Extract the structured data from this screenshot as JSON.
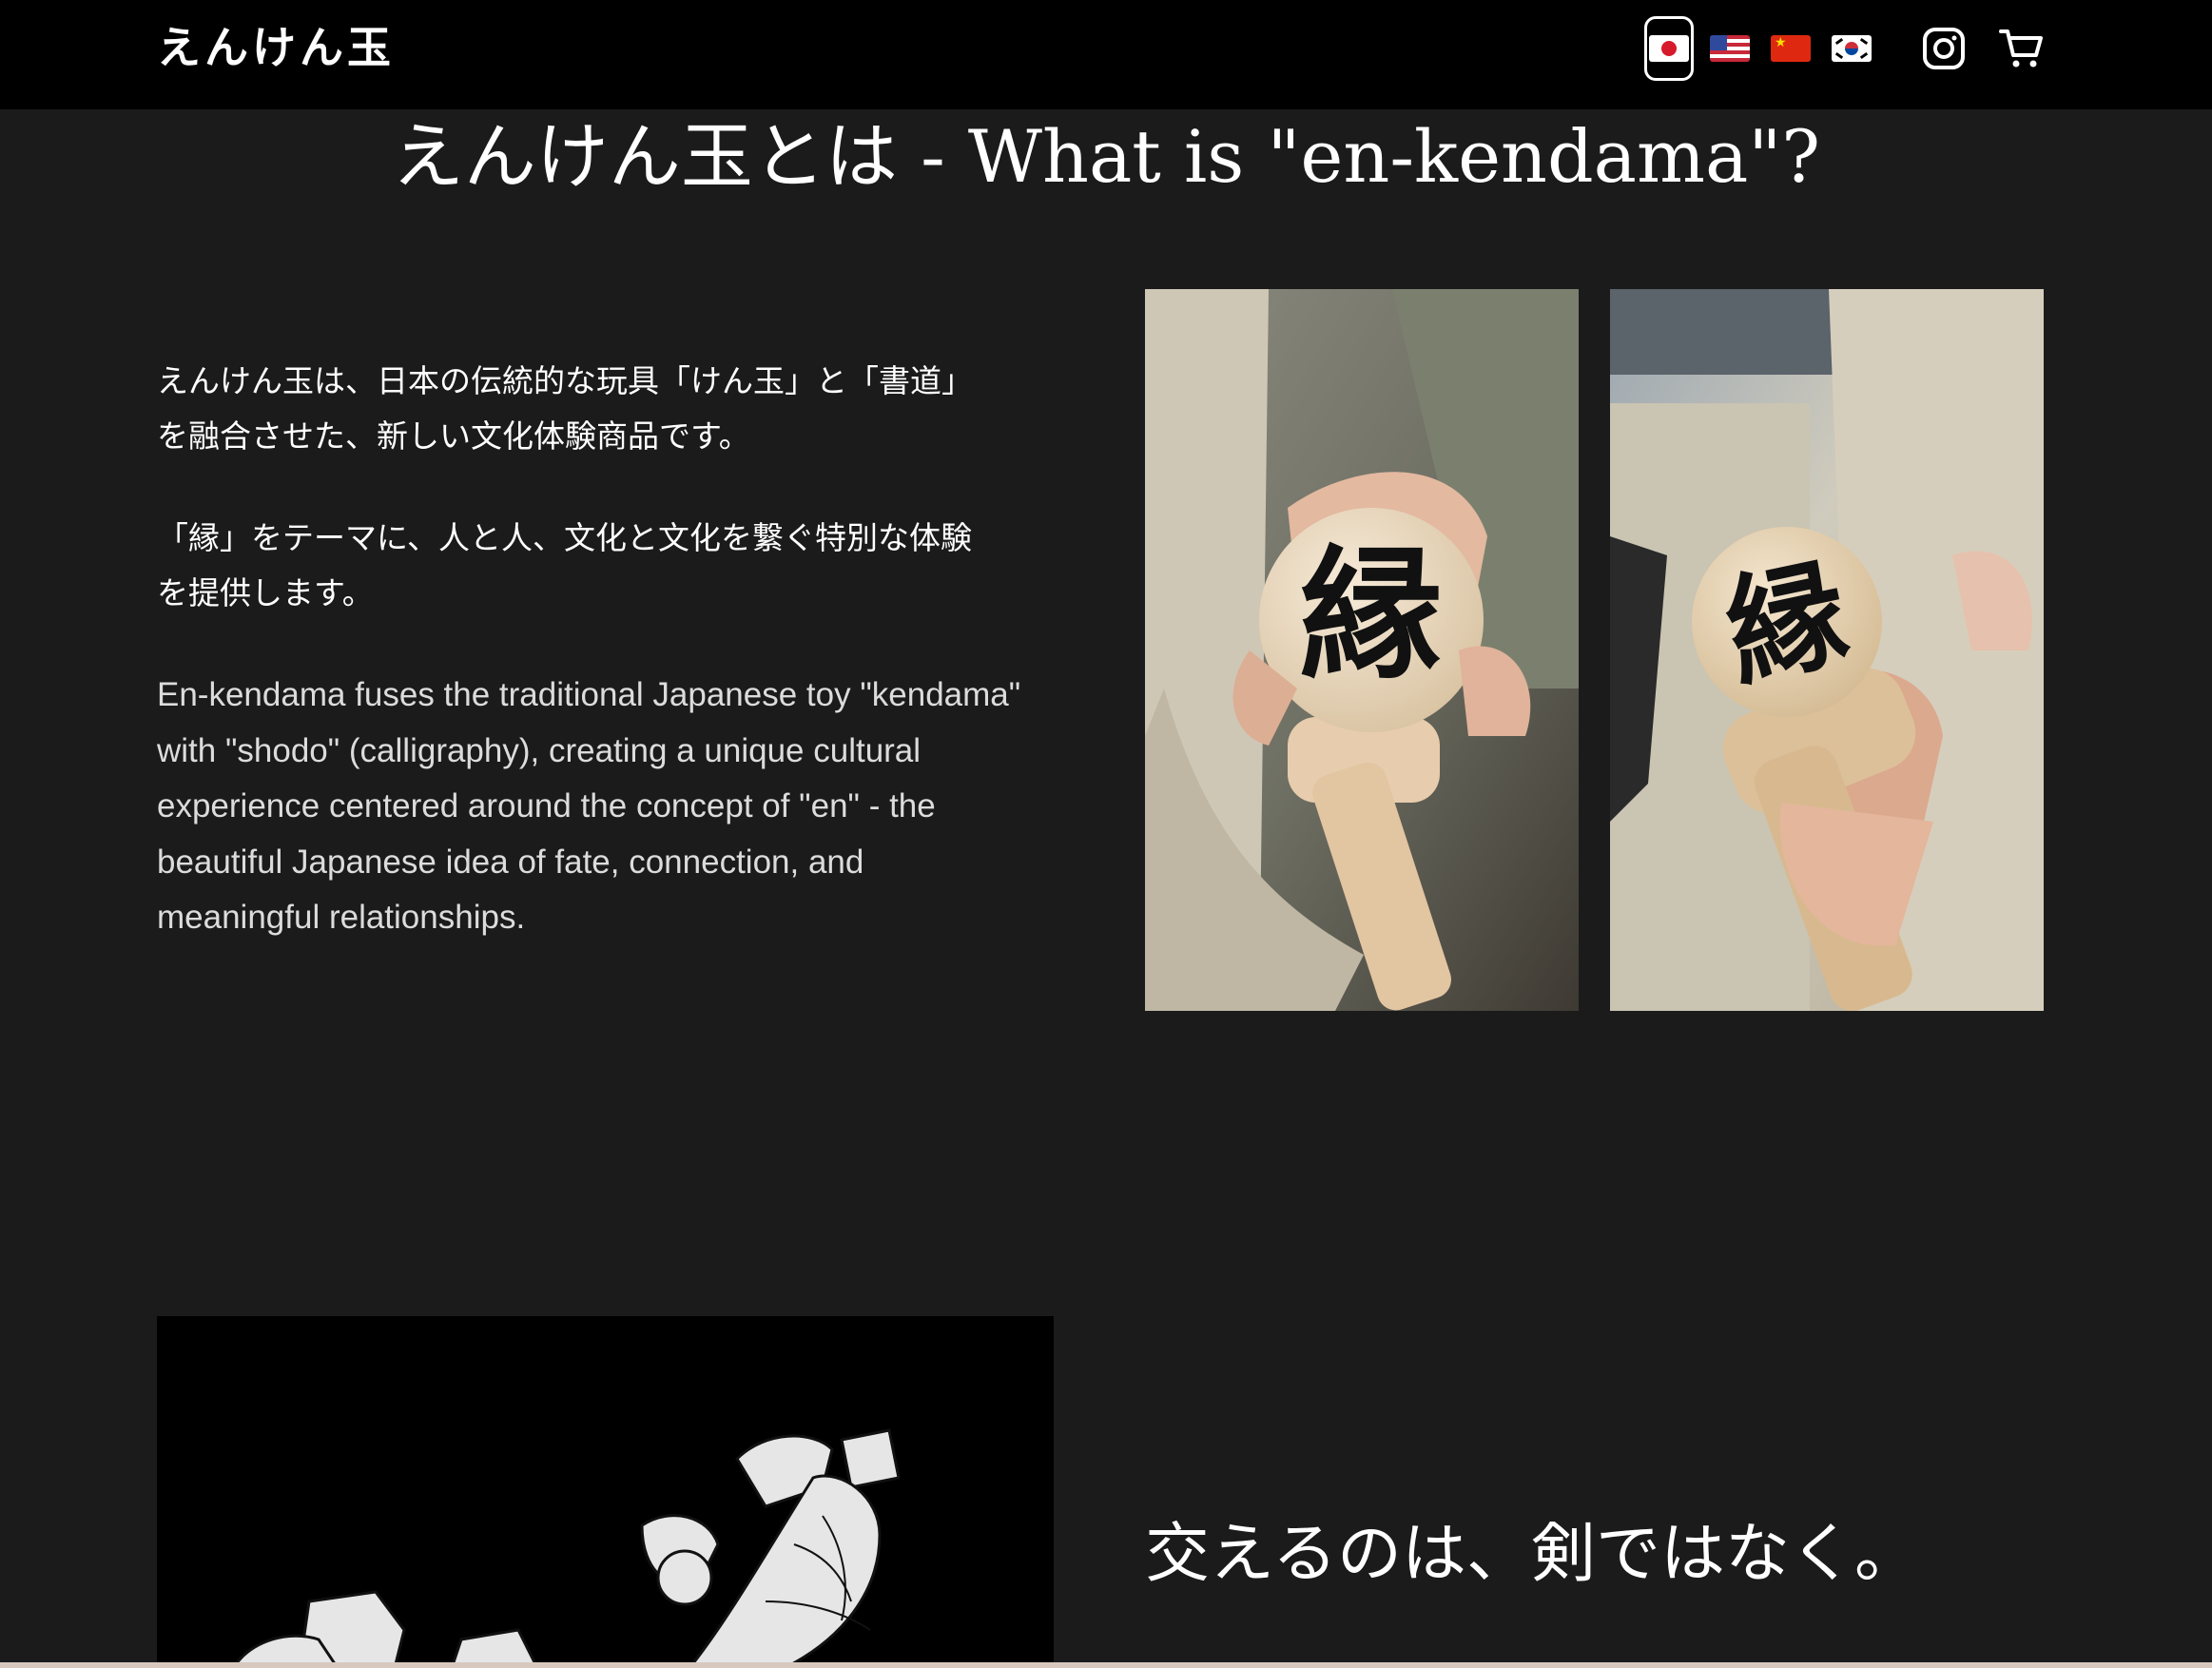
{
  "header": {
    "logo": "えんけん玉",
    "languages": [
      {
        "code": "ja",
        "icon": "japan-flag-icon",
        "active": true
      },
      {
        "code": "en",
        "icon": "usa-flag-icon",
        "active": false
      },
      {
        "code": "zh",
        "icon": "china-flag-icon",
        "active": false
      },
      {
        "code": "ko",
        "icon": "korea-flag-icon",
        "active": false
      }
    ],
    "icons": [
      "instagram-icon",
      "cart-icon"
    ]
  },
  "about": {
    "title": "えんけん玉とは - What is \"en-kendama\"?",
    "jp_para1_line1": "えんけん玉は、日本の伝統的な玩具「けん玉」と「書道」",
    "jp_para1_line2": "を融合させた、新しい文化体験商品です。",
    "jp_para2_line1": "「縁」をテーマに、人と人、文化と文化を繋ぐ特別な体験",
    "jp_para2_line2": "を提供します。",
    "en_lines": [
      "En-kendama fuses the traditional Japanese toy \"kendama\"",
      "with \"shodo\" (calligraphy), creating a unique cultural",
      "experience centered around the concept of \"en\" - the",
      "beautiful Japanese idea of fate, connection, and",
      "meaningful relationships."
    ],
    "photo_glyph": "縁"
  },
  "section2": {
    "subhead": "交えるのは、剣ではなく。"
  },
  "colors": {
    "header_bg": "#000000",
    "page_bg": "#1b1b1b",
    "text": "#ffffff"
  }
}
